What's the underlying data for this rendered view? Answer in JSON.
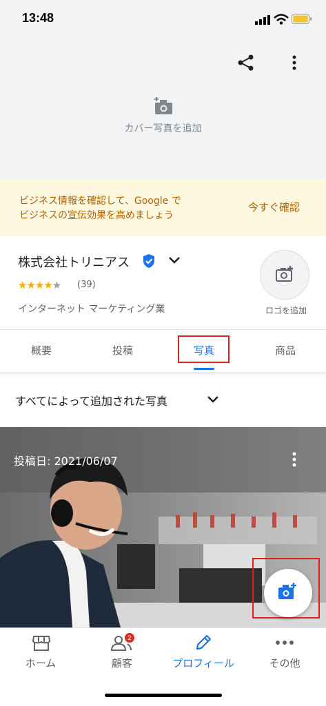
{
  "status_bar": {
    "time": "13:48"
  },
  "cover": {
    "add_cover_label": "カバー写真を追加"
  },
  "banner": {
    "line1": "ビジネス情報を確認して、Google で",
    "line2": "ビジネスの宣伝効果を高めましょう",
    "action": "今すぐ確認"
  },
  "business": {
    "name": "株式会社トリニアス",
    "rating": 4,
    "stars_filled": "★★★★",
    "stars_empty": "★",
    "review_count": "(39)",
    "category": "インターネット マーケティング業",
    "add_logo_label": "ロゴを追加"
  },
  "tabs": [
    {
      "label": "概要"
    },
    {
      "label": "投稿"
    },
    {
      "label": "写真"
    },
    {
      "label": "商品"
    }
  ],
  "photos": {
    "filter_label": "すべてによって追加された写真",
    "post_date": "投稿日: 2021/06/07"
  },
  "bottom_nav": [
    {
      "label": "ホーム"
    },
    {
      "label": "顧客",
      "badge": "2"
    },
    {
      "label": "プロフィール"
    },
    {
      "label": "その他"
    }
  ],
  "colors": {
    "accent": "#1a73e8",
    "banner_text": "#b06000",
    "highlight_box": "#e02020",
    "star": "#f9ab00"
  }
}
